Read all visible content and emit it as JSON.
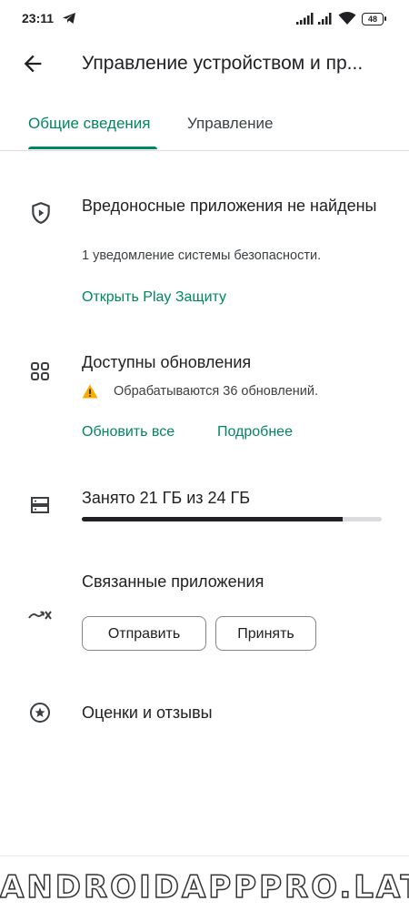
{
  "status_bar": {
    "time": "23:11",
    "battery": "48"
  },
  "app_bar": {
    "title": "Управление устройством и пр..."
  },
  "tabs": [
    {
      "label": "Общие сведения",
      "selected": true
    },
    {
      "label": "Управление",
      "selected": false
    }
  ],
  "malware": {
    "icon": "shield-play-icon",
    "title": "Вредоносные приложения не найдены",
    "subtitle": "1 уведомление системы безопасности.",
    "link": "Открыть Play Защиту"
  },
  "updates": {
    "icon": "apps-grid-icon",
    "title": "Доступны обновления",
    "status_icon": "warning-icon",
    "status": "Обрабатываются 36 обновлений.",
    "update_all": "Обновить все",
    "details": "Подробнее"
  },
  "storage": {
    "icon": "storage-icon",
    "text": "Занято 21 ГБ из 24 ГБ",
    "used_fraction": 0.87
  },
  "linked": {
    "icon": "sync-disabled-icon",
    "title": "Связанные приложения",
    "send": "Отправить",
    "accept": "Принять"
  },
  "ratings": {
    "icon": "star-circle-icon",
    "title": "Оценки и отзывы"
  },
  "watermark": "ANDROIDAPPPRO.LAT",
  "colors": {
    "accent": "#01875f",
    "text": "#202124",
    "warning": "#f9ab00"
  }
}
